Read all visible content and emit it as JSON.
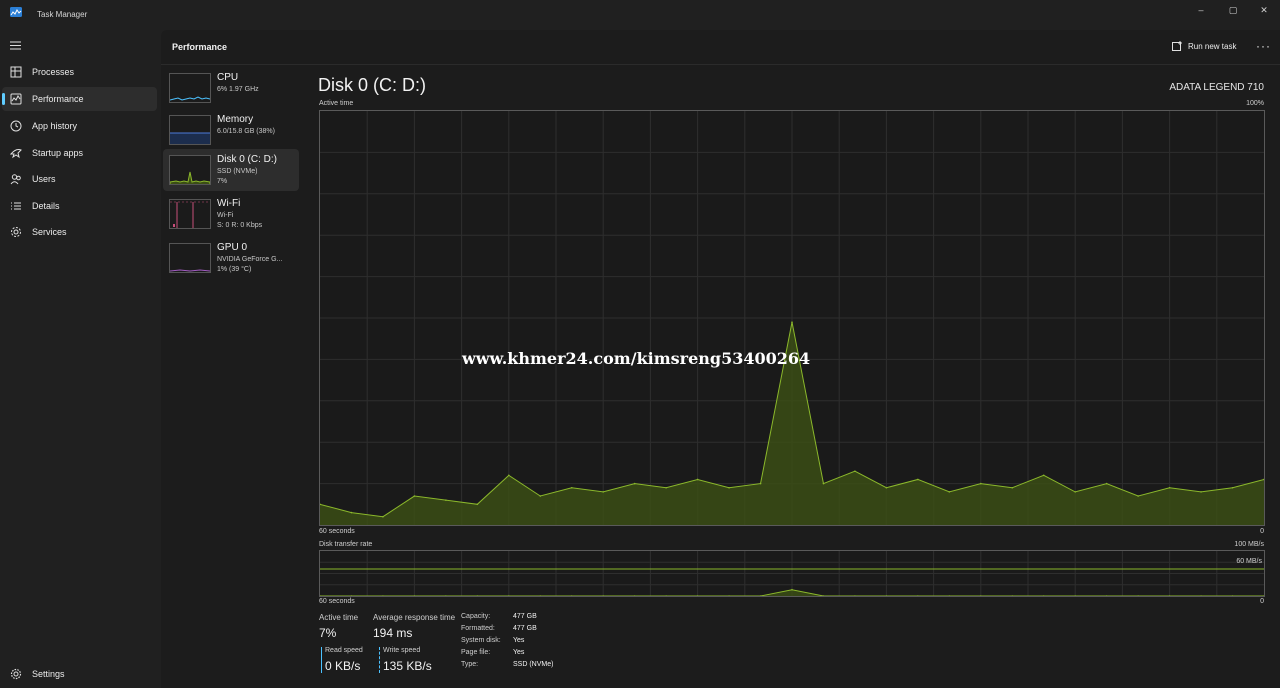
{
  "window": {
    "title": "Task Manager",
    "controls": {
      "minimize": "–",
      "maximize": "▢",
      "close": "✕"
    }
  },
  "sidebar": {
    "items": [
      {
        "label": "Processes",
        "icon": "processes-icon"
      },
      {
        "label": "Performance",
        "icon": "performance-icon",
        "active": true
      },
      {
        "label": "App history",
        "icon": "history-icon"
      },
      {
        "label": "Startup apps",
        "icon": "startup-icon"
      },
      {
        "label": "Users",
        "icon": "users-icon"
      },
      {
        "label": "Details",
        "icon": "details-icon"
      },
      {
        "label": "Services",
        "icon": "services-icon"
      }
    ],
    "settings_label": "Settings"
  },
  "header": {
    "title": "Performance",
    "run_task_label": "Run new task",
    "more_label": "···"
  },
  "devices": [
    {
      "name": "CPU",
      "line1": "6%  1.97 GHz",
      "line2": "",
      "color": "#4cc2ff"
    },
    {
      "name": "Memory",
      "line1": "6.0/15.8 GB (38%)",
      "line2": "",
      "color": "#4c7ad8"
    },
    {
      "name": "Disk 0 (C: D:)",
      "line1": "SSD (NVMe)",
      "line2": "7%",
      "color": "#8bb82b",
      "active": true
    },
    {
      "name": "Wi-Fi",
      "line1": "Wi-Fi",
      "line2": "S: 0  R: 0 Kbps",
      "color": "#c74f7a"
    },
    {
      "name": "GPU 0",
      "line1": "NVIDIA GeForce G...",
      "line2": "1% (39 °C)",
      "color": "#a35dc2"
    }
  ],
  "detail": {
    "title": "Disk 0 (C: D:)",
    "model": "ADATA LEGEND 710",
    "active_graph": {
      "label": "Active time",
      "max_label": "100%",
      "time_label": "60 seconds",
      "min_label": "0"
    },
    "transfer_graph": {
      "label": "Disk transfer rate",
      "max_label": "100 MB/s",
      "ref_label": "60 MB/s",
      "time_label": "60 seconds",
      "min_label": "0"
    },
    "stats": {
      "active_time_label": "Active time",
      "active_time_value": "7%",
      "response_label": "Average response time",
      "response_value": "194 ms",
      "read_label": "Read speed",
      "read_value": "0 KB/s",
      "write_label": "Write speed",
      "write_value": "135 KB/s"
    },
    "properties": [
      {
        "key": "Capacity:",
        "value": "477 GB"
      },
      {
        "key": "Formatted:",
        "value": "477 GB"
      },
      {
        "key": "System disk:",
        "value": "Yes"
      },
      {
        "key": "Page file:",
        "value": "Yes"
      },
      {
        "key": "Type:",
        "value": "SSD (NVMe)"
      }
    ]
  },
  "chart_data": [
    {
      "type": "area",
      "title": "Active time",
      "ylim": [
        0,
        100
      ],
      "x": [
        60,
        58,
        56,
        54,
        52,
        50,
        48,
        46,
        44,
        42,
        40,
        38,
        36,
        34,
        32,
        30,
        28,
        26,
        24,
        22,
        20,
        18,
        16,
        14,
        12,
        10,
        8,
        6,
        4,
        2,
        0
      ],
      "values": [
        5,
        3,
        2,
        7,
        6,
        5,
        12,
        7,
        9,
        8,
        10,
        9,
        11,
        9,
        10,
        49,
        10,
        13,
        9,
        11,
        8,
        10,
        9,
        12,
        8,
        10,
        7,
        9,
        8,
        9,
        11
      ],
      "color": "#8bb82b"
    },
    {
      "type": "area",
      "title": "Disk transfer rate",
      "ylim": [
        0,
        100
      ],
      "x": [
        60,
        58,
        56,
        54,
        52,
        50,
        48,
        46,
        44,
        42,
        40,
        38,
        36,
        34,
        32,
        30,
        28,
        26,
        24,
        22,
        20,
        18,
        16,
        14,
        12,
        10,
        8,
        6,
        4,
        2,
        0
      ],
      "values": [
        0,
        0,
        0,
        0,
        0,
        0,
        0,
        0,
        0,
        0,
        0,
        0,
        0,
        0,
        0,
        14,
        0,
        0,
        0,
        0,
        0,
        0,
        0,
        0,
        0,
        0,
        0,
        0,
        0,
        0,
        0
      ],
      "color": "#8bb82b"
    }
  ],
  "watermark": "www.khmer24.com/kimsreng53400264"
}
